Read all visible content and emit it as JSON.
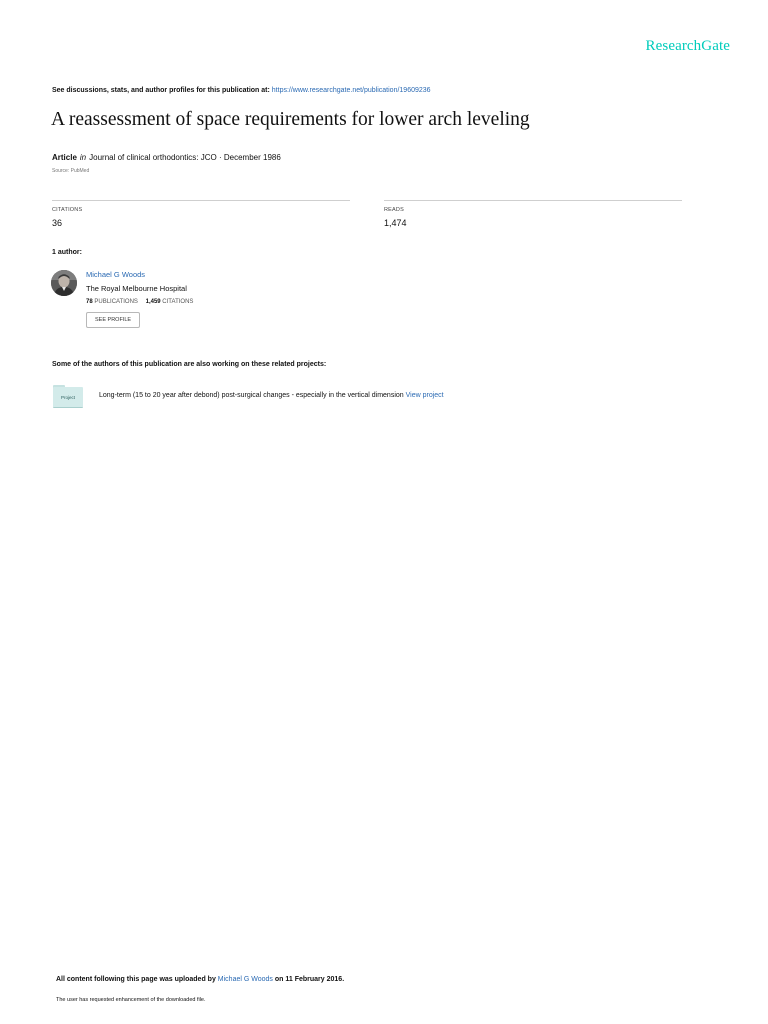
{
  "brand": {
    "name": "ResearchGate"
  },
  "header": {
    "see_text": "See discussions, stats, and author profiles for this publication at:",
    "url": "https://www.researchgate.net/publication/19609236"
  },
  "publication": {
    "title": "A reassessment of space requirements for lower arch leveling",
    "type": "Article",
    "in_label": "in",
    "venue": "Journal of clinical orthodontics: JCO · December 1986",
    "source": "Source: PubMed"
  },
  "stats": {
    "citations": {
      "label": "CITATIONS",
      "value": "36"
    },
    "reads": {
      "label": "READS",
      "value": "1,474"
    }
  },
  "authors": {
    "count_label": "1 author:",
    "items": [
      {
        "name": "Michael G Woods",
        "institution": "The Royal Melbourne Hospital",
        "publications_count": "78",
        "publications_label": "PUBLICATIONS",
        "citations_count": "1,459",
        "citations_label": "CITATIONS",
        "profile_button": "SEE PROFILE"
      }
    ]
  },
  "related": {
    "heading": "Some of the authors of this publication are also working on these related projects:",
    "projects": [
      {
        "icon_label": "Project",
        "title": "Long-term (15 to 20 year after debond) post-surgical changes - especially in the vertical dimension",
        "link": "View project"
      }
    ]
  },
  "footer": {
    "upload_prefix": "All content following this page was uploaded by",
    "uploader": "Michael G Woods",
    "upload_suffix": "on 11 February 2016.",
    "note": "The user has requested enhancement of the downloaded file."
  },
  "colors": {
    "brand": "#00ccbb",
    "link": "#2b6ab3",
    "project_folder": "#d3ebea"
  }
}
